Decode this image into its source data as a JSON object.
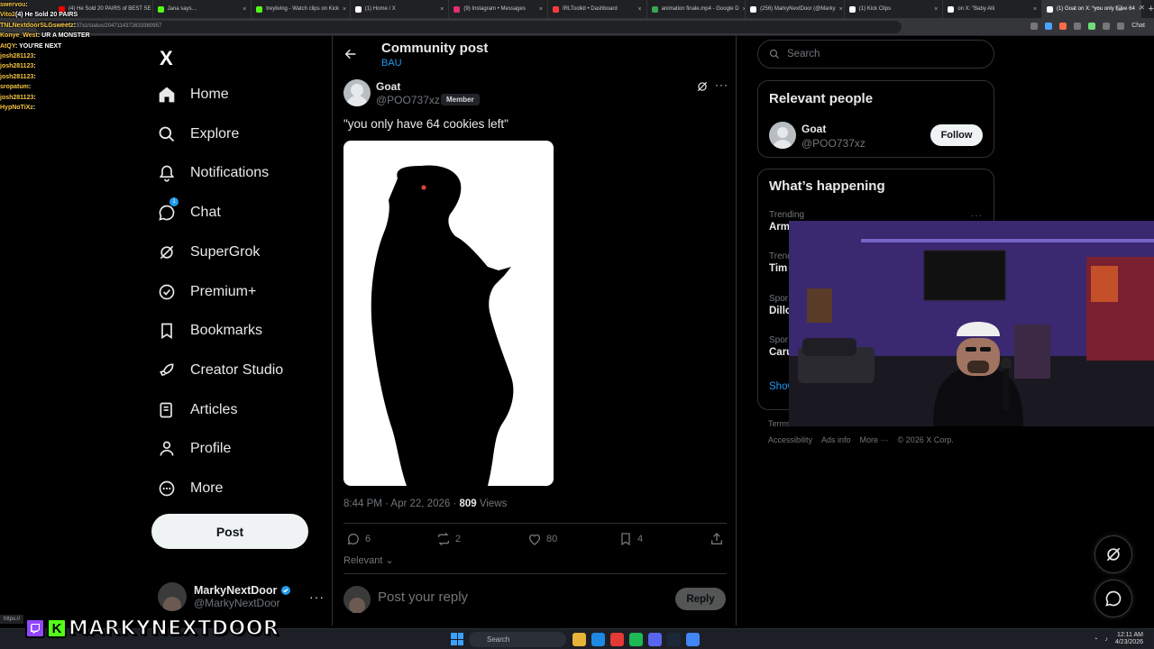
{
  "browser": {
    "tabs": [
      {
        "label": "(4) He Sold 20 PAIRS of BEST SE",
        "color": "#ff0000"
      },
      {
        "label": "Jana says…",
        "color": "#53fc18"
      },
      {
        "label": "treyliving - Watch clips on Kick",
        "color": "#53fc18"
      },
      {
        "label": "(1) Home / X",
        "color": "#ffffff"
      },
      {
        "label": "(9) Instagram • Messages",
        "color": "#e1306c"
      },
      {
        "label": "IRLToolkit • Dashboard",
        "color": "#ff3b3b"
      },
      {
        "label": "animation finale.mp4 - Google D",
        "color": "#34a853"
      },
      {
        "label": "(256) MarkyNextDoor (@Marky",
        "color": "#ffffff"
      },
      {
        "label": "(1) Kick Clips",
        "color": "#ffffff"
      },
      {
        "label": "on X: \"Baby Alli",
        "color": "#ffffff"
      },
      {
        "label": "(1) Goat on X: \"you only have 64",
        "color": "#ffffff"
      }
    ],
    "url": "x.com/POO737xz/status/2047114372633380957",
    "chat_label": "Chat"
  },
  "twitch_chat": [
    {
      "user": "swervou",
      "text": ":"
    },
    {
      "user": "Vito2",
      "text": "(4) He Sold 20 PAIRS"
    },
    {
      "user": "TNLNextdoorSLGsweetz",
      "text": ":"
    },
    {
      "user": "Konye_West",
      "text": ": UR A MONSTER"
    },
    {
      "user": "AtQY",
      "text": ": YOU'RE NEXT"
    },
    {
      "user": "josh281123",
      "text": ":"
    },
    {
      "user": "josh281123",
      "text": ":"
    },
    {
      "user": "josh281123",
      "text": ":"
    },
    {
      "user": "sropatum",
      "text": ":"
    },
    {
      "user": "josh281123",
      "text": ":"
    },
    {
      "user": "HypNoTiXz",
      "text": ":"
    }
  ],
  "nav": {
    "logo": "X",
    "items": [
      {
        "label": "Home",
        "icon": "home-icon"
      },
      {
        "label": "Explore",
        "icon": "search-icon"
      },
      {
        "label": "Notifications",
        "icon": "bell-icon"
      },
      {
        "label": "Chat",
        "icon": "chat-icon",
        "badge": "1"
      },
      {
        "label": "SuperGrok",
        "icon": "grok-icon"
      },
      {
        "label": "Premium+",
        "icon": "premium-icon"
      },
      {
        "label": "Bookmarks",
        "icon": "bookmark-icon"
      },
      {
        "label": "Creator Studio",
        "icon": "rocket-icon"
      },
      {
        "label": "Articles",
        "icon": "article-icon"
      },
      {
        "label": "Profile",
        "icon": "person-icon"
      },
      {
        "label": "More",
        "icon": "more-circle-icon"
      }
    ],
    "post_label": "Post",
    "account": {
      "name": "MarkyNextDoor",
      "handle": "@MarkyNextDoor",
      "more": "···"
    }
  },
  "header": {
    "title": "Community post",
    "subtitle": "BAU"
  },
  "post": {
    "author": "Goat",
    "handle": "@POO737xz",
    "badge": "Member",
    "text": "\"you only have 64 cookies left\"",
    "time": "8:44 PM · Apr 22, 2026 · ",
    "views": "809",
    "views_label": " Views",
    "replies": "6",
    "reposts": "2",
    "likes": "80",
    "bookmarks": "4",
    "sort_label": "Relevant",
    "reply_placeholder": "Post your reply",
    "reply_button": "Reply",
    "more": "···"
  },
  "sidebar": {
    "search_placeholder": "Search",
    "relevant_title": "Relevant people",
    "person": {
      "name": "Goat",
      "handle": "@POO737xz",
      "follow_label": "Follow"
    },
    "happening_title": "What’s happening",
    "trends": [
      {
        "category": "Trending",
        "name": "Arm"
      },
      {
        "category": "Trend",
        "name": "Tim"
      },
      {
        "category": "Spor",
        "name": "Dillo"
      },
      {
        "category": "Spor",
        "name": "Caru"
      }
    ],
    "show_more": "Show",
    "trend_more": "···",
    "footer_row1": [
      "Terms"
    ],
    "footer_row2": [
      "Accessibility",
      "Ads info",
      "More ···",
      "© 2026 X Corp."
    ]
  },
  "overlay": {
    "brand_name": "MARKYNEXTDOOR",
    "kick_letter": "K",
    "status_url": "https://"
  },
  "taskbar": {
    "search_label": "Search",
    "time": "12:11 AM",
    "date": "4/23/2026"
  },
  "colors": {
    "accent": "#1d9bf0",
    "background": "#000000",
    "border": "#2f3336",
    "muted_text": "#71767b",
    "twitch_purple": "#9146ff",
    "kick_green": "#53fc18"
  }
}
